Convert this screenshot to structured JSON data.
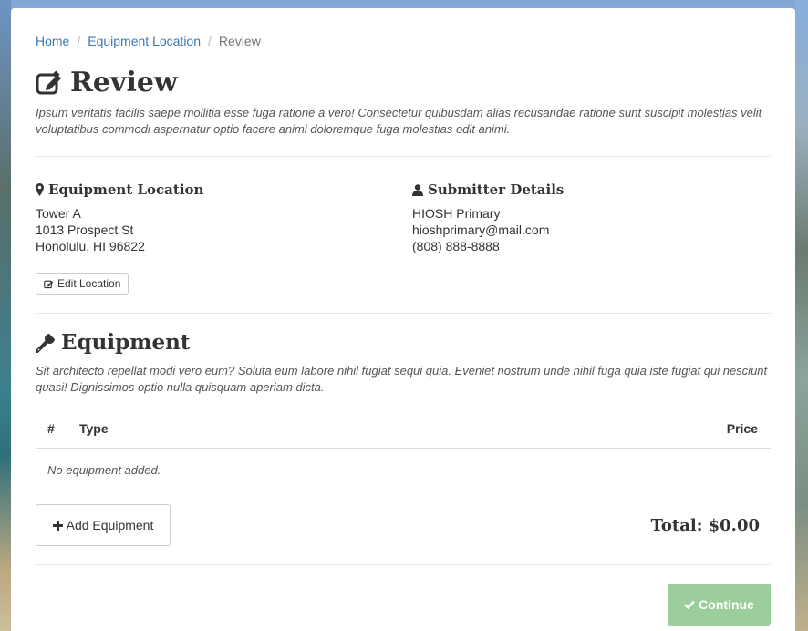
{
  "breadcrumb": {
    "home": "Home",
    "equipment_location": "Equipment Location",
    "current": "Review",
    "separator": "/"
  },
  "header": {
    "title": "Review",
    "icon": "edit-icon"
  },
  "intro": "Ipsum veritatis facilis saepe mollitia esse fuga ratione a vero! Consectetur quibusdam alias recusandae ratione sunt suscipit molestias velit voluptatibus commodi aspernatur optio facere animi doloremque fuga molestias odit animi.",
  "location": {
    "title": "Equipment Location",
    "icon": "map-marker-icon",
    "line1": "Tower A",
    "line2": "1013 Prospect St",
    "line3": "Honolulu, HI 96822",
    "edit_label": "Edit Location"
  },
  "submitter": {
    "title": "Submitter Details",
    "icon": "user-icon",
    "name": "HIOSH Primary",
    "email": "hioshprimary@mail.com",
    "phone": "(808) 888-8888"
  },
  "equipment": {
    "title": "Equipment",
    "icon": "wrench-icon",
    "description": "Sit architecto repellat modi vero eum? Soluta eum labore nihil fugiat sequi quia. Eveniet nostrum unde nihil fuga quia iste fugiat qui nesciunt quasi! Dignissimos optio nulla quisquam aperiam dicta.",
    "columns": {
      "num": "#",
      "type": "Type",
      "price": "Price"
    },
    "empty_text": "No equipment added.",
    "add_label": "Add Equipment",
    "total_label": "Total: $0.00"
  },
  "continue_label": "Continue",
  "colors": {
    "link": "#3a78b6",
    "success_disabled": "#9ccd9c"
  }
}
